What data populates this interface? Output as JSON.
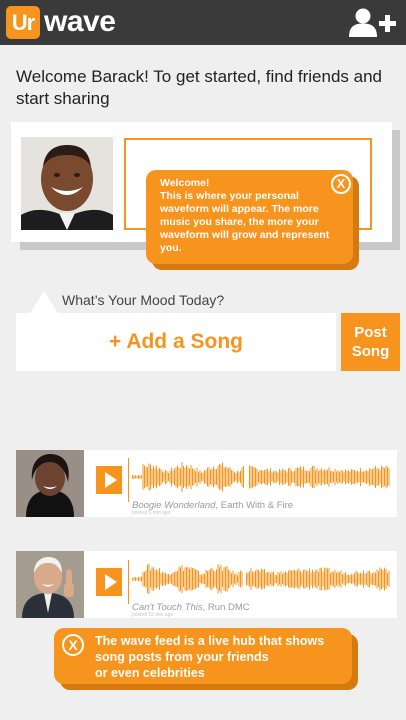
{
  "header": {
    "logo_badge": "Ur",
    "logo_text": "wave",
    "add_friend_icon": "add-user-icon"
  },
  "welcome": {
    "message": "Welcome Barack! To get started, find friends and start sharing"
  },
  "profile": {
    "photo_icon": "user-photo"
  },
  "tooltip_waveform": {
    "text": "Welcome!\nThis is where your personal waveform will appear. The more music you share, the more your waveform will grow and represent you.",
    "close_label": "X"
  },
  "composer": {
    "mood_prompt": "What’s Your Mood Today?",
    "add_song_label": "+ Add a Song",
    "post_song_label": "Post\nSong"
  },
  "feed": {
    "posts": [
      {
        "song_title": "Boogie Wonderland",
        "artist": ", Earth With & Fire",
        "posted": "posted 5 min ago"
      },
      {
        "song_title": "Can't Touch This",
        "artist": ", Run DMC",
        "posted": "posted 12 min ago"
      }
    ]
  },
  "tooltip_feed": {
    "text": "The wave feed is a live hub that shows\nsong posts from your friends\nor even celebrities",
    "close_label": "X"
  },
  "colors": {
    "accent": "#f7941d",
    "header_bg": "#3a3a3a",
    "page_bg": "#efefef"
  }
}
